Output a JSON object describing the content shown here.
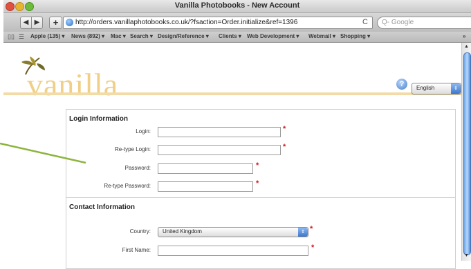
{
  "window": {
    "title": "Vanilla Photobooks - New Account"
  },
  "toolbar": {
    "back_glyph": "◀",
    "forward_glyph": "▶",
    "add_glyph": "+",
    "url": "http://orders.vanillaphotobooks.co.uk/?fsaction=Order.initialize&ref=1396",
    "reload_glyph": "C",
    "search_placeholder": "Q- Google"
  },
  "bookmarks": {
    "items": [
      "Apple (135) ▾",
      "News (892) ▾",
      "Mac ▾",
      "Search ▾",
      "Design/Reference ▾",
      "Clients ▾",
      "Web Development ▾",
      "Webmail ▾",
      "Shopping ▾"
    ],
    "overflow": "»"
  },
  "header": {
    "logo_text": "vanilla",
    "help_glyph": "?",
    "language": "English",
    "accent_color": "#f0cf86"
  },
  "form": {
    "login_section": {
      "title": "Login Information",
      "fields": [
        {
          "label": "Login:",
          "value": ""
        },
        {
          "label": "Re-type Login:",
          "value": ""
        },
        {
          "label": "Password:",
          "value": ""
        },
        {
          "label": "Re-type Password:",
          "value": ""
        }
      ]
    },
    "contact_section": {
      "title": "Contact Information",
      "country_label": "Country:",
      "country_value": "United Kingdom",
      "first_name_label": "First Name:"
    },
    "required_marker": "*",
    "required_color": "#d4131b"
  },
  "annotation": {
    "line_color": "#8db53c"
  }
}
